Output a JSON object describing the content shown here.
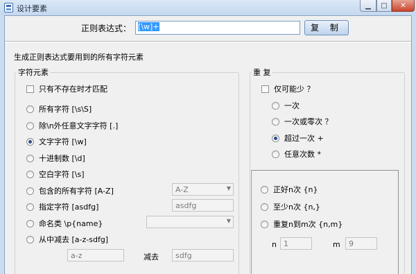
{
  "window": {
    "title": "设计要素"
  },
  "regex": {
    "label": "正则表达式：",
    "value": "[\\w]+"
  },
  "copy_button": "复 制",
  "gen_label": "生成正则表达式要用到的所有字符元素",
  "char_elements": {
    "legend": "字符元素",
    "match_absent": "只有不存在时才匹配",
    "options": [
      {
        "label": "所有字符  [\\s\\S]",
        "selected": false
      },
      {
        "label": "除\\n外任意文字字符  [.]",
        "selected": false
      },
      {
        "label": "文字字符  [\\w]",
        "selected": true
      },
      {
        "label": "十进制数  [\\d]",
        "selected": false
      },
      {
        "label": "空白字符  [\\s]",
        "selected": false
      },
      {
        "label": "包含的所有字符 [A-Z]",
        "selected": false
      },
      {
        "label": "指定字符  [asdfg]",
        "selected": false
      },
      {
        "label": "命名类 \\p{name}",
        "selected": false
      },
      {
        "label": "从中减去  [a-z-sdfg]",
        "selected": false
      }
    ],
    "range_combo": "A-Z",
    "specified_value": "asdfg",
    "named_combo": "",
    "subtract_from": "a-z",
    "subtract_label": "减去",
    "subtract_value": "sdfg"
  },
  "repeat": {
    "legend": "重  复",
    "lazy": "仅可能少 ？",
    "options": [
      {
        "label": "一次",
        "selected": false
      },
      {
        "label": "一次或零次  ？",
        "selected": false
      },
      {
        "label": "超过一次  +",
        "selected": true
      },
      {
        "label": "任意次数  *",
        "selected": false
      }
    ],
    "count_options": [
      {
        "label": "正好n次  {n}",
        "selected": false
      },
      {
        "label": "至少n次  {n,}",
        "selected": false
      },
      {
        "label": "重复n到m次  {n,m}",
        "selected": false
      }
    ],
    "n_label": "n",
    "n_value": "1",
    "m_label": "m",
    "m_value": "9"
  }
}
